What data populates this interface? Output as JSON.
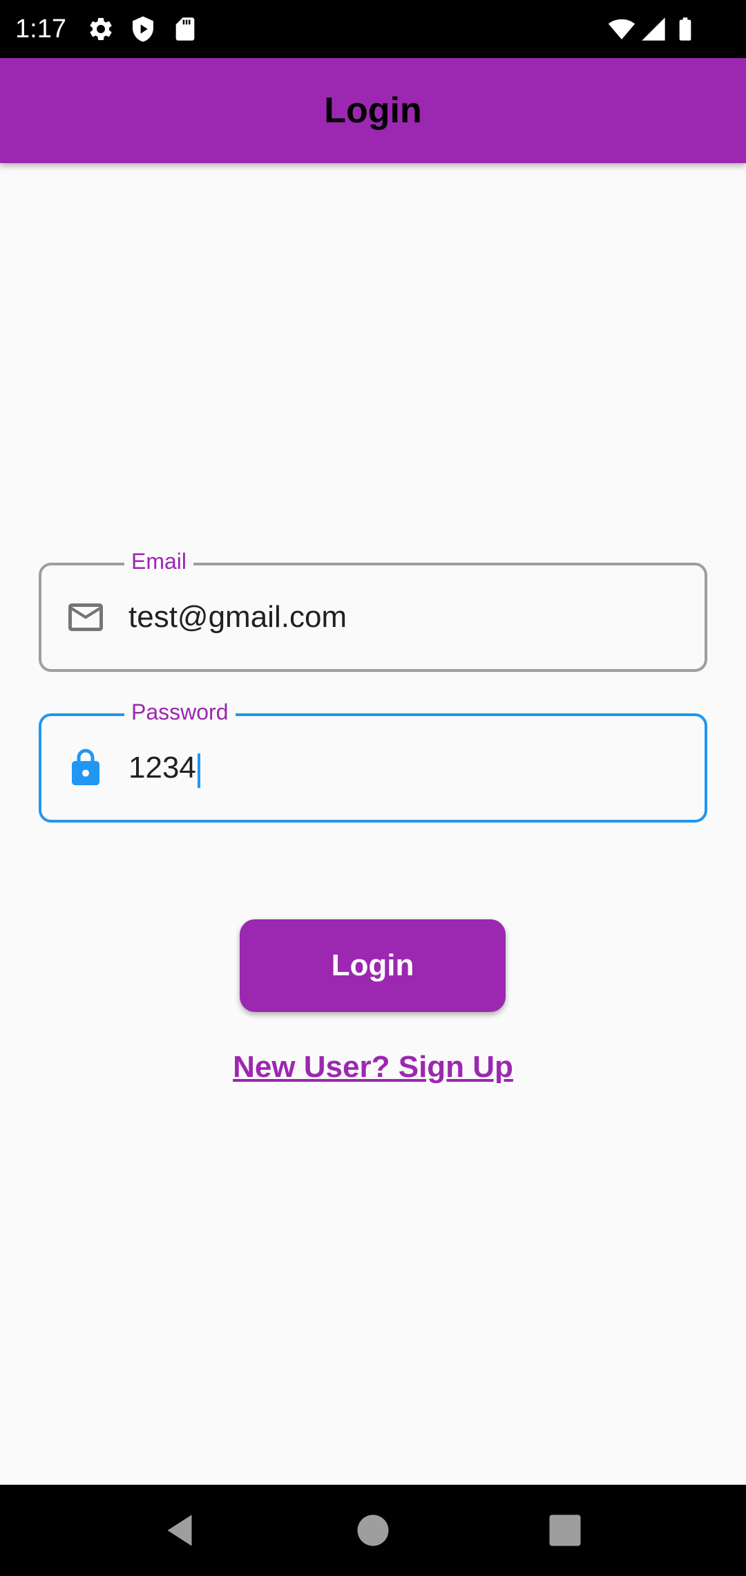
{
  "status_bar": {
    "time": "1:17",
    "left_icons": [
      "settings-icon",
      "shield-play-icon",
      "sd-card-icon"
    ],
    "right_icons": [
      "wifi-icon",
      "signal-icon",
      "battery-icon"
    ]
  },
  "app_bar": {
    "title": "Login",
    "color": "#9c27b0"
  },
  "form": {
    "email": {
      "label": "Email",
      "value": "test@gmail.com",
      "icon": "mail-icon"
    },
    "password": {
      "label": "Password",
      "value": "1234",
      "icon": "lock-icon",
      "focused": true,
      "focus_color": "#2196f3"
    }
  },
  "actions": {
    "login_label": "Login",
    "signup_label": "New User? Sign Up"
  },
  "nav_bar": {
    "buttons": [
      "back-icon",
      "home-icon",
      "recents-icon"
    ]
  }
}
